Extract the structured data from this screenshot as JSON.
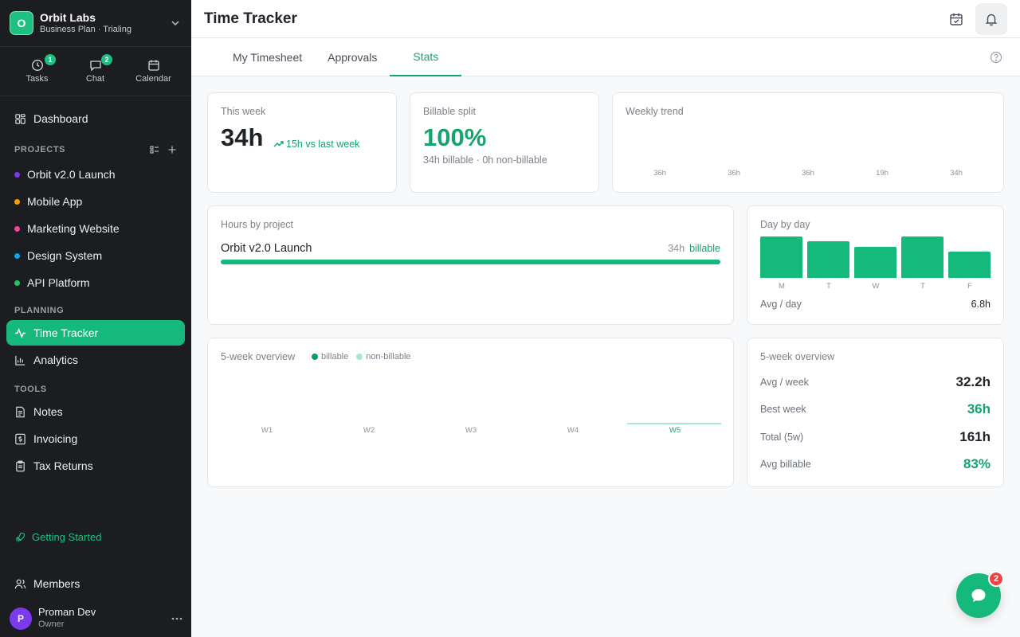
{
  "org": {
    "logo_letter": "O",
    "name": "Orbit Labs",
    "plan": "Business Plan · Trialing"
  },
  "quick": [
    {
      "label": "Tasks",
      "badge": "1",
      "icon": "tasks-icon"
    },
    {
      "label": "Chat",
      "badge": "2",
      "icon": "chat-icon"
    },
    {
      "label": "Calendar",
      "icon": "calendar-icon"
    }
  ],
  "nav": {
    "dashboard": "Dashboard",
    "time_tracker": "Time Tracker",
    "analytics": "Analytics",
    "notes": "Notes",
    "invoicing": "Invoicing",
    "tax_returns": "Tax Returns",
    "members": "Members",
    "getting_started": "Getting Started"
  },
  "sections": {
    "projects": "PROJECTS",
    "planning": "PLANNING",
    "tools": "TOOLS"
  },
  "projects": [
    {
      "name": "Orbit v2.0 Launch",
      "color": "#7c3aed"
    },
    {
      "name": "Mobile App",
      "color": "#f59e0b"
    },
    {
      "name": "Marketing Website",
      "color": "#ec4899"
    },
    {
      "name": "Design System",
      "color": "#0ea5e9"
    },
    {
      "name": "API Platform",
      "color": "#22c55e"
    }
  ],
  "user": {
    "initial": "P",
    "name": "Proman Dev",
    "role": "Owner"
  },
  "header": {
    "title": "Time Tracker"
  },
  "tabs": [
    "My Timesheet",
    "Approvals",
    "Stats"
  ],
  "this_week": {
    "title": "This week",
    "value": "34h",
    "delta": "15h vs last week"
  },
  "billable_split": {
    "title": "Billable split",
    "value": "100%",
    "sub": "34h billable · 0h non-billable"
  },
  "weekly_trend": {
    "title": "Weekly trend",
    "labels": [
      "36h",
      "36h",
      "36h",
      "19h",
      "34h"
    ]
  },
  "hours_by_project": {
    "title": "Hours by project",
    "project": "Orbit v2.0 Launch",
    "hours": "34h",
    "tag": "billable",
    "share": 1.0
  },
  "day_by_day": {
    "title": "Day by day",
    "days": [
      "M",
      "T",
      "W",
      "T",
      "F"
    ],
    "values": [
      8.0,
      7.0,
      6.0,
      8.0,
      5.0
    ],
    "avg_label": "Avg / day",
    "avg_value": "6.8h"
  },
  "overview_chart": {
    "title": "5-week overview",
    "legend": [
      "billable",
      "non-billable"
    ],
    "weeks": [
      "W1",
      "W2",
      "W3",
      "W4",
      "W5"
    ],
    "colors": {
      "billable": "#0f9d66",
      "non_billable": "#a6e9cb"
    }
  },
  "overview_stats": {
    "title": "5-week overview",
    "rows": [
      {
        "label": "Avg / week",
        "value": "32.2h",
        "color": "#1f2328"
      },
      {
        "label": "Best week",
        "value": "36h",
        "color": "#15a36e"
      },
      {
        "label": "Total (5w)",
        "value": "161h",
        "color": "#1f2328"
      },
      {
        "label": "Avg billable",
        "value": "83%",
        "color": "#15a36e"
      }
    ]
  },
  "fab": {
    "badge": "2"
  },
  "colors": {
    "accent": "#15b97c",
    "sidebar_bg": "#1c1d21"
  }
}
